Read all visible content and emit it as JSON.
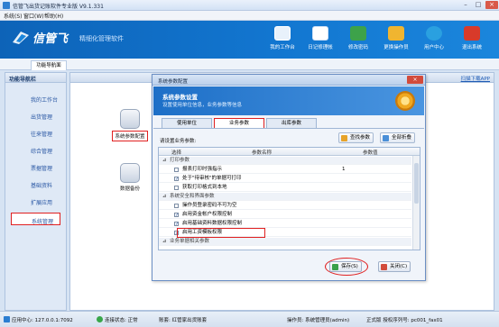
{
  "window": {
    "title": "信管飞出货记账软件专业版 V9.1.331"
  },
  "menu": [
    "系统(S)",
    "窗口(W)",
    "帮助(H)"
  ],
  "banner": {
    "logo": "信管飞",
    "slogan": "精细化管理软件",
    "buttons": [
      "我的工作台",
      "日记修理帐",
      "修改密码",
      "更换操作员",
      "用户中心",
      "退出系统"
    ]
  },
  "tabs": {
    "home": "功能导航面"
  },
  "nav": {
    "header": "功能导航栏",
    "items": [
      "我的工作台",
      "出货管理",
      "往来管理",
      "综合管理",
      "票据管理",
      "基础资料",
      "扩展应用",
      "系统管理"
    ]
  },
  "content": {
    "fullscreen": "扫描下载APP",
    "tiles": [
      "系统参数配置",
      "数据备份"
    ]
  },
  "dialog": {
    "title": "系统参数配置",
    "banner_title": "系统参数设置",
    "banner_sub": "设置使用单位信息，业务参数等信息",
    "tabs": [
      "使用单位",
      "业务参数",
      "出库参数"
    ],
    "set_label": "请设置业务参数:",
    "btn_find": "查找参数",
    "btn_collapse": "全部折叠",
    "columns": [
      "选择",
      "参数名称",
      "参数值"
    ],
    "rows": [
      {
        "type": "group",
        "name": "打印参数"
      },
      {
        "type": "item",
        "checked": false,
        "name": "报表打印时强指示",
        "value": "1"
      },
      {
        "type": "item",
        "checked": true,
        "name": "处于\"待审核\"的单据可打印",
        "value": ""
      },
      {
        "type": "item",
        "checked": false,
        "name": "获取打印格式到本地",
        "value": ""
      },
      {
        "type": "group",
        "name": "系统安全和界面参数"
      },
      {
        "type": "item",
        "checked": false,
        "name": "操作员登录密码不可为空",
        "value": ""
      },
      {
        "type": "item",
        "checked": true,
        "name": "启用资金帐户权限控制",
        "value": ""
      },
      {
        "type": "item",
        "checked": true,
        "name": "启用基础资料数据权限控制",
        "value": ""
      },
      {
        "type": "item",
        "checked": true,
        "name": "启用工资模板权限",
        "value": ""
      },
      {
        "type": "group",
        "name": "业务单据相关参数"
      }
    ],
    "btn_save": "保存(S)",
    "btn_close": "关闭(C)"
  },
  "status": {
    "center": "应用中心: 127.0.0.1:7092",
    "conn": "连接状态: 正常",
    "account": "账套: 红管家出货账套",
    "operator": "操作员: 系统管理员(admin)",
    "license": "正式版 授权序列号: pc001_fax01"
  }
}
